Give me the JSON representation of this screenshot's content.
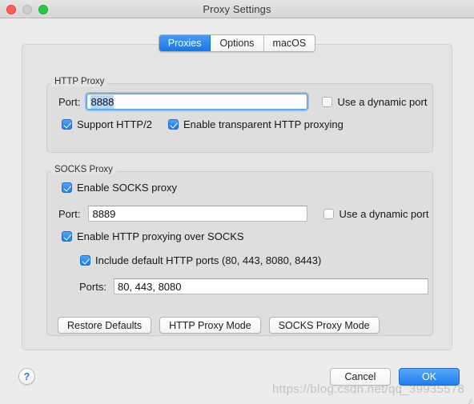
{
  "window": {
    "title": "Proxy Settings",
    "traffic_lights": [
      "close",
      "minimize",
      "zoom"
    ]
  },
  "tabs": [
    {
      "label": "Proxies",
      "active": true
    },
    {
      "label": "Options",
      "active": false
    },
    {
      "label": "macOS",
      "active": false
    }
  ],
  "http_proxy": {
    "group_title": "HTTP Proxy",
    "port_label": "Port:",
    "port_value": "8888",
    "port_focused": true,
    "port_selected": true,
    "dynamic_port": {
      "label": "Use a dynamic port",
      "checked": false
    },
    "support_http2": {
      "label": "Support HTTP/2",
      "checked": true
    },
    "transparent_proxying": {
      "label": "Enable transparent HTTP proxying",
      "checked": true
    }
  },
  "socks_proxy": {
    "group_title": "SOCKS Proxy",
    "enable_socks": {
      "label": "Enable SOCKS proxy",
      "checked": true
    },
    "port_label": "Port:",
    "port_value": "8889",
    "dynamic_port": {
      "label": "Use a dynamic port",
      "checked": false
    },
    "http_over_socks": {
      "label": "Enable HTTP proxying over SOCKS",
      "checked": true
    },
    "include_default_ports": {
      "label": "Include default HTTP ports (80, 443, 8080, 8443)",
      "checked": true
    },
    "ports_label": "Ports:",
    "ports_value": "80, 443, 8080"
  },
  "mode_buttons": [
    {
      "label": "Restore Defaults"
    },
    {
      "label": "HTTP Proxy Mode"
    },
    {
      "label": "SOCKS Proxy Mode"
    }
  ],
  "dialog_buttons": {
    "cancel": "Cancel",
    "ok": "OK"
  },
  "help": {
    "glyph": "?"
  },
  "watermark": {
    "text": "https://blog.csdn.net/qq_39935578"
  },
  "colors": {
    "accent": "#1c7fee",
    "selection": "#b6d6fb",
    "window_bg": "#ececec",
    "panel_bg": "#e4e4e4",
    "group_bg": "#dededf",
    "close_light": "#fc5d57",
    "min_light": "#cdcdcd",
    "zoom_light": "#2bc840"
  }
}
